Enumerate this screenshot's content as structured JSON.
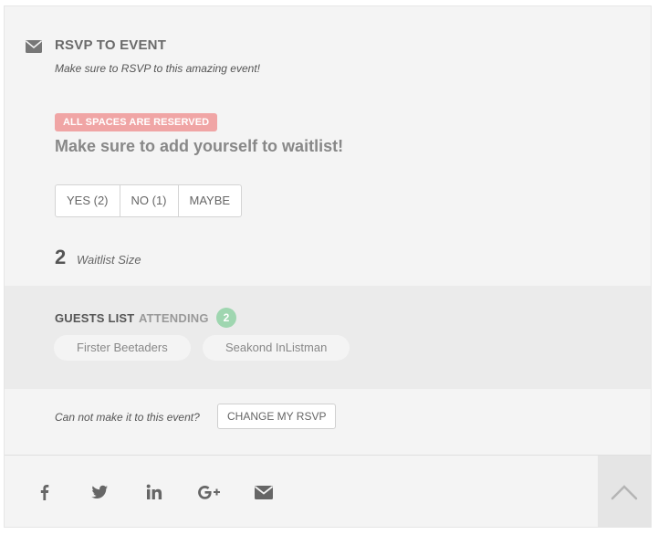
{
  "event": {
    "icon": "envelope-icon",
    "title": "RSVP TO EVENT",
    "subtitle": "Make sure to RSVP to this amazing event!",
    "status_badge": "ALL SPACES ARE RESERVED",
    "waitlist_message": "Make sure to add yourself to waitlist!"
  },
  "rsvp_buttons": [
    "YES (2)",
    "NO (1)",
    "MAYBE"
  ],
  "waitlist": {
    "count": "2",
    "label": "Waitlist Size"
  },
  "guests": {
    "title": "GUESTS LIST",
    "attending_label": "ATTENDING",
    "attending_count": "2",
    "names": [
      "Firster Beetaders",
      "Seakond InListman"
    ]
  },
  "change": {
    "prompt": "Can not make it to this event?",
    "button_label": "CHANGE MY RSVP"
  },
  "social": {
    "icons": [
      "facebook-icon",
      "twitter-icon",
      "linkedin-icon",
      "google-plus-icon",
      "envelope-icon"
    ],
    "scroll_top_icon": "chevron-up-icon"
  },
  "colors": {
    "card_bg": "#f4f4f4",
    "guests_bg": "#ebebeb",
    "badge_reserved": "#f0a5a5",
    "attending_badge": "#9fd6b0",
    "icon_gray": "#666666"
  }
}
